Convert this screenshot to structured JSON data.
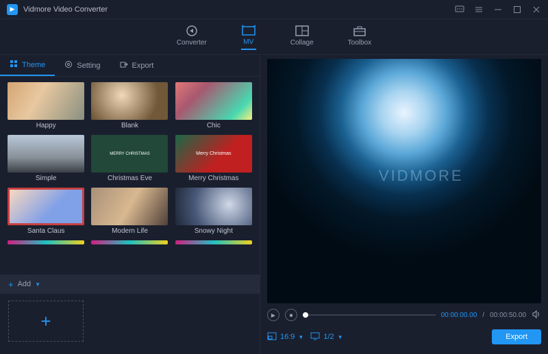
{
  "app": {
    "title": "Vidmore Video Converter"
  },
  "mainTabs": [
    {
      "label": "Converter"
    },
    {
      "label": "MV"
    },
    {
      "label": "Collage"
    },
    {
      "label": "Toolbox"
    }
  ],
  "subTabs": [
    {
      "label": "Theme"
    },
    {
      "label": "Setting"
    },
    {
      "label": "Export"
    }
  ],
  "themes": [
    {
      "label": "Happy"
    },
    {
      "label": "Blank"
    },
    {
      "label": "Chic"
    },
    {
      "label": "Simple"
    },
    {
      "label": "Christmas Eve"
    },
    {
      "label": "Merry Christmas"
    },
    {
      "label": "Santa Claus"
    },
    {
      "label": "Modern Life"
    },
    {
      "label": "Snowy Night"
    }
  ],
  "addButton": {
    "label": "Add"
  },
  "preview": {
    "watermark": "VIDMORE"
  },
  "player": {
    "current": "00:00:00.00",
    "total": "00:00:50.00"
  },
  "aspect": {
    "ratio": "16:9",
    "fraction": "1/2"
  },
  "export": {
    "label": "Export"
  }
}
